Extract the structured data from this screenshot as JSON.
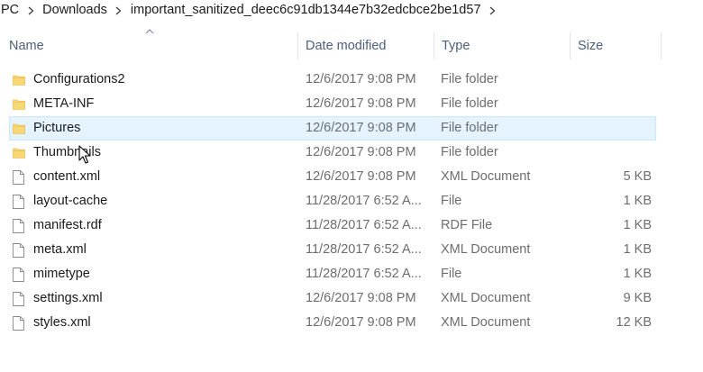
{
  "breadcrumb": [
    "PC",
    "Downloads",
    "important_sanitized_deec6c91db1344e7b32edcbce2be1d57"
  ],
  "columns": {
    "name": "Name",
    "date": "Date modified",
    "type": "Type",
    "size": "Size"
  },
  "rows": [
    {
      "icon": "folder-icon",
      "name": "Configurations2",
      "date": "12/6/2017 9:08 PM",
      "type": "File folder",
      "size": ""
    },
    {
      "icon": "folder-icon",
      "name": "META-INF",
      "date": "12/6/2017 9:08 PM",
      "type": "File folder",
      "size": ""
    },
    {
      "icon": "folder-icon",
      "name": "Pictures",
      "date": "12/6/2017 9:08 PM",
      "type": "File folder",
      "size": ""
    },
    {
      "icon": "folder-icon",
      "name": "Thumbnails",
      "date": "12/6/2017 9:08 PM",
      "type": "File folder",
      "size": ""
    },
    {
      "icon": "file-icon",
      "name": "content.xml",
      "date": "12/6/2017 9:08 PM",
      "type": "XML Document",
      "size": "5 KB"
    },
    {
      "icon": "file-icon",
      "name": "layout-cache",
      "date": "11/28/2017 6:52 A...",
      "type": "File",
      "size": "1 KB"
    },
    {
      "icon": "file-icon",
      "name": "manifest.rdf",
      "date": "11/28/2017 6:52 A...",
      "type": "RDF File",
      "size": "1 KB"
    },
    {
      "icon": "file-icon",
      "name": "meta.xml",
      "date": "11/28/2017 6:52 A...",
      "type": "XML Document",
      "size": "1 KB"
    },
    {
      "icon": "file-icon",
      "name": "mimetype",
      "date": "11/28/2017 6:52 A...",
      "type": "File",
      "size": "1 KB"
    },
    {
      "icon": "file-icon",
      "name": "settings.xml",
      "date": "12/6/2017 9:08 PM",
      "type": "XML Document",
      "size": "9 KB"
    },
    {
      "icon": "file-icon",
      "name": "styles.xml",
      "date": "12/6/2017 9:08 PM",
      "type": "XML Document",
      "size": "12 KB"
    }
  ],
  "selected_row": "Pictures",
  "colors": {
    "selection_bg": "#e5f3ff",
    "selection_border": "#cce8ff",
    "header_text": "#4c607a",
    "folder": "#f8d775"
  }
}
